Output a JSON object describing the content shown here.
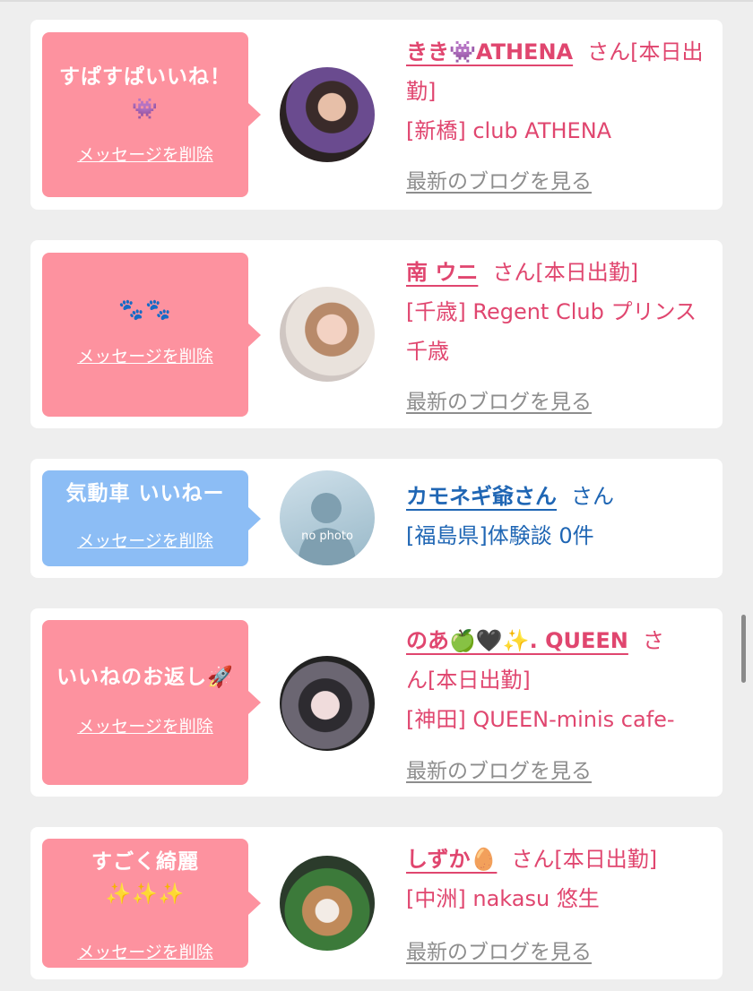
{
  "delete_label": "メッセージを削除",
  "blog_label": "最新のブログを見る",
  "items": [
    {
      "msg_line1": "すぱすぱいいね！",
      "msg_line2": "👾",
      "name": "きき👾ATHENA",
      "san": "さん",
      "status": "[本日出勤]",
      "shop": "[新橋] club ATHENA",
      "bubble_color": "#fd929f"
    },
    {
      "msg_line1": "🐾🐾",
      "name": "南 ウニ",
      "san": "さん",
      "status": "[本日出勤]",
      "shop": "[千歳] Regent Club プリンス 千歳",
      "bubble_color": "#fd929f"
    },
    {
      "msg_line1": "気動車 いいねー",
      "name": "カモネギ爺さん",
      "san": "さん",
      "detail": "[福島県]体験談 0件",
      "avatar_text": "no photo",
      "bubble_color": "#8cbdf5"
    },
    {
      "msg_line1": "いいねのお返し🚀",
      "name": "のあ🍏🖤✨. QUEEN",
      "san": "さ",
      "status": "ん[本日出勤]",
      "shop": "[神田] QUEEN-minis cafe-",
      "bubble_color": "#fd929f"
    },
    {
      "msg_line1": "すごく綺麗",
      "msg_line2": "✨✨✨",
      "name": "しずか🥚",
      "san": "さん",
      "status": "[本日出勤]",
      "shop": "[中洲] nakasu 悠生",
      "bubble_color": "#fd929f"
    }
  ]
}
